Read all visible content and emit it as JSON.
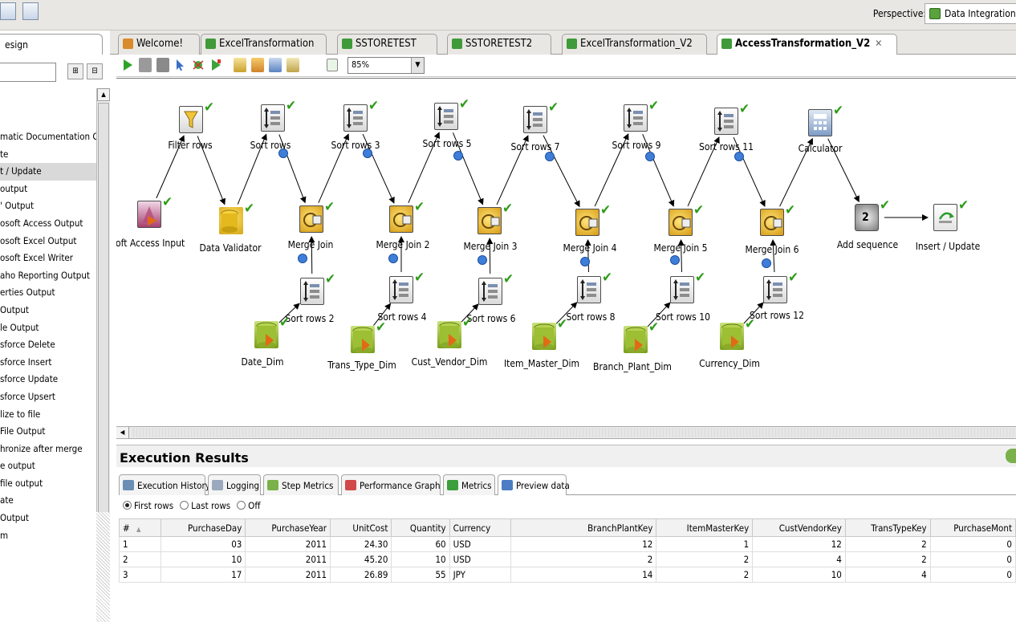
{
  "perspective": {
    "label": "Perspective:",
    "value": "Data Integration"
  },
  "left_panel": {
    "tab_label": "esign",
    "items": [
      "matic Documentation O",
      "te",
      "t / Update",
      "output",
      "' Output",
      "osoft Access Output",
      "osoft Excel Output",
      "osoft Excel Writer",
      "aho Reporting Output",
      "erties Output",
      "Output",
      "le Output",
      "sforce Delete",
      "sforce Insert",
      "sforce Update",
      "sforce Upsert",
      "lize to file",
      "File Output",
      "hronize after merge",
      "e output",
      "file output",
      "ate",
      "Output",
      "m"
    ],
    "selected_index": 2
  },
  "editor_tabs": [
    {
      "label": "Welcome!",
      "active": false
    },
    {
      "label": "ExcelTransformation",
      "active": false
    },
    {
      "label": "SSTORETEST",
      "active": false
    },
    {
      "label": "SSTORETEST2",
      "active": false
    },
    {
      "label": "ExcelTransformation_V2",
      "active": false
    },
    {
      "label": "AccessTransformation_V2",
      "active": true
    }
  ],
  "toolbar": {
    "zoom": "85%"
  },
  "steps": {
    "filter_rows": "Filter rows",
    "sort_rows": "Sort rows",
    "sort_rows_3": "Sort rows 3",
    "sort_rows_5": "Sort rows 5",
    "sort_rows_7": "Sort rows 7",
    "sort_rows_9": "Sort rows 9",
    "sort_rows_11": "Sort rows 11",
    "calculator": "Calculator",
    "access_input": "osoft Access Input",
    "data_validator": "Data Validator",
    "merge_join": "Merge Join",
    "merge_join_2": "Merge Join 2",
    "merge_join_3": "Merge Join 3",
    "merge_join_4": "Merge Join 4",
    "merge_join_5": "Merge Join 5",
    "merge_join_6": "Merge Join 6",
    "add_sequence": "Add sequence",
    "insert_update": "Insert / Update",
    "sort_rows_2": "Sort rows 2",
    "sort_rows_4": "Sort rows 4",
    "sort_rows_6": "Sort rows 6",
    "sort_rows_8": "Sort rows 8",
    "sort_rows_10": "Sort rows 10",
    "sort_rows_12": "Sort rows 12",
    "date_dim": "Date_Dim",
    "trans_type_dim": "Trans_Type_Dim",
    "cust_vendor_dim": "Cust_Vendor_Dim",
    "item_master_dim": "Item_Master_Dim",
    "branch_plant_dim": "Branch_Plant_Dim",
    "currency_dim": "Currency_Dim",
    "add_sequence_badge": "2"
  },
  "results": {
    "title": "Execution Results",
    "tabs": [
      "Execution History",
      "Logging",
      "Step Metrics",
      "Performance Graph",
      "Metrics",
      "Preview data"
    ],
    "active_tab": 5,
    "radios": [
      {
        "label": "First rows",
        "checked": true
      },
      {
        "label": "Last rows",
        "checked": false
      },
      {
        "label": "Off",
        "checked": false
      }
    ],
    "columns": [
      "#",
      "PurchaseDay",
      "PurchaseYear",
      "UnitCost",
      "Quantity",
      "Currency",
      "BranchPlantKey",
      "ItemMasterKey",
      "CustVendorKey",
      "TransTypeKey",
      "PurchaseMont"
    ],
    "rows": [
      [
        "1",
        "03",
        "2011",
        "24.30",
        "60",
        "USD",
        "12",
        "1",
        "12",
        "2",
        "0"
      ],
      [
        "2",
        "10",
        "2011",
        "45.20",
        "10",
        "USD",
        "2",
        "2",
        "4",
        "2",
        "0"
      ],
      [
        "3",
        "17",
        "2011",
        "26.89",
        "55",
        "JPY",
        "14",
        "2",
        "10",
        "4",
        "0"
      ]
    ]
  }
}
